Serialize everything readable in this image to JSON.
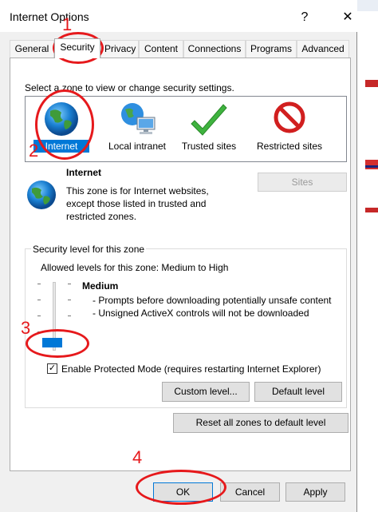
{
  "window": {
    "title": "Internet Options",
    "help_glyph": "?",
    "close_glyph": "✕"
  },
  "tabs": [
    {
      "label": "General"
    },
    {
      "label": "Security",
      "active": true
    },
    {
      "label": "Privacy"
    },
    {
      "label": "Content"
    },
    {
      "label": "Connections"
    },
    {
      "label": "Programs"
    },
    {
      "label": "Advanced"
    }
  ],
  "security": {
    "zone_prompt": "Select a zone to view or change security settings.",
    "zones": [
      {
        "label": "Internet",
        "icon": "globe-icon",
        "selected": true
      },
      {
        "label": "Local intranet",
        "icon": "local-intranet-icon"
      },
      {
        "label": "Trusted sites",
        "icon": "checkmark-icon"
      },
      {
        "label": "Restricted sites",
        "icon": "no-entry-icon"
      }
    ],
    "selected_zone": {
      "title": "Internet",
      "description": "This zone is for Internet websites, except those listed in trusted and restricted zones.",
      "sites_label": "Sites"
    },
    "level_group": {
      "legend": "Security level for this zone",
      "allowed": "Allowed levels for this zone: Medium to High",
      "level_name": "Medium",
      "level_desc": "- Prompts before downloading potentially unsafe content\n- Unsigned ActiveX controls will not be downloaded",
      "protected_mode_label": "Enable Protected Mode (requires restarting Internet Explorer)",
      "protected_mode_checked": "✓",
      "custom_label": "Custom level...",
      "default_label": "Default level"
    },
    "reset_label": "Reset all zones to default level"
  },
  "footer": {
    "ok_label": "OK",
    "cancel_label": "Cancel",
    "apply_label": "Apply"
  },
  "annotations": {
    "numbers": [
      "1",
      "2",
      "3",
      "4"
    ],
    "color": "#e6191c"
  },
  "colors": {
    "accent": "#0078d7",
    "annotation": "#e6191c"
  }
}
